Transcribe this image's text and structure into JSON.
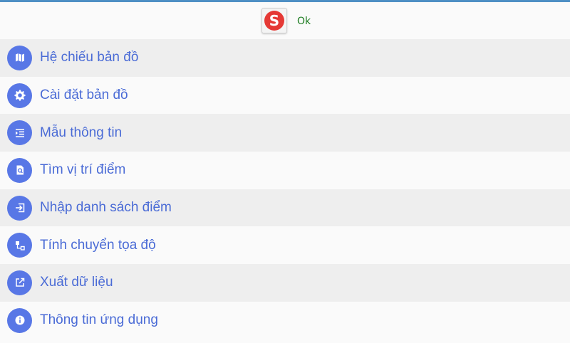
{
  "header": {
    "logo_letter": "S",
    "status_text": "Ok"
  },
  "menu": {
    "items": [
      {
        "label": "Hệ chiếu bản đồ",
        "icon": "map-icon"
      },
      {
        "label": "Cài đặt bản đồ",
        "icon": "gear-icon"
      },
      {
        "label": "Mẫu thông tin",
        "icon": "list-indent-icon"
      },
      {
        "label": "Tìm vị trí điểm",
        "icon": "file-search-icon"
      },
      {
        "label": "Nhập danh sách điểm",
        "icon": "import-icon"
      },
      {
        "label": "Tính chuyển tọa độ",
        "icon": "coordinate-transform-icon"
      },
      {
        "label": "Xuất dữ liệu",
        "icon": "export-icon"
      },
      {
        "label": "Thông tin ứng dụng",
        "icon": "info-icon"
      }
    ]
  },
  "colors": {
    "top_line": "#4e8fc4",
    "icon_bg": "#5877e6",
    "label_text": "#4a6bd6",
    "ok_text": "#1e7d22",
    "logo_red": "#e53935"
  }
}
